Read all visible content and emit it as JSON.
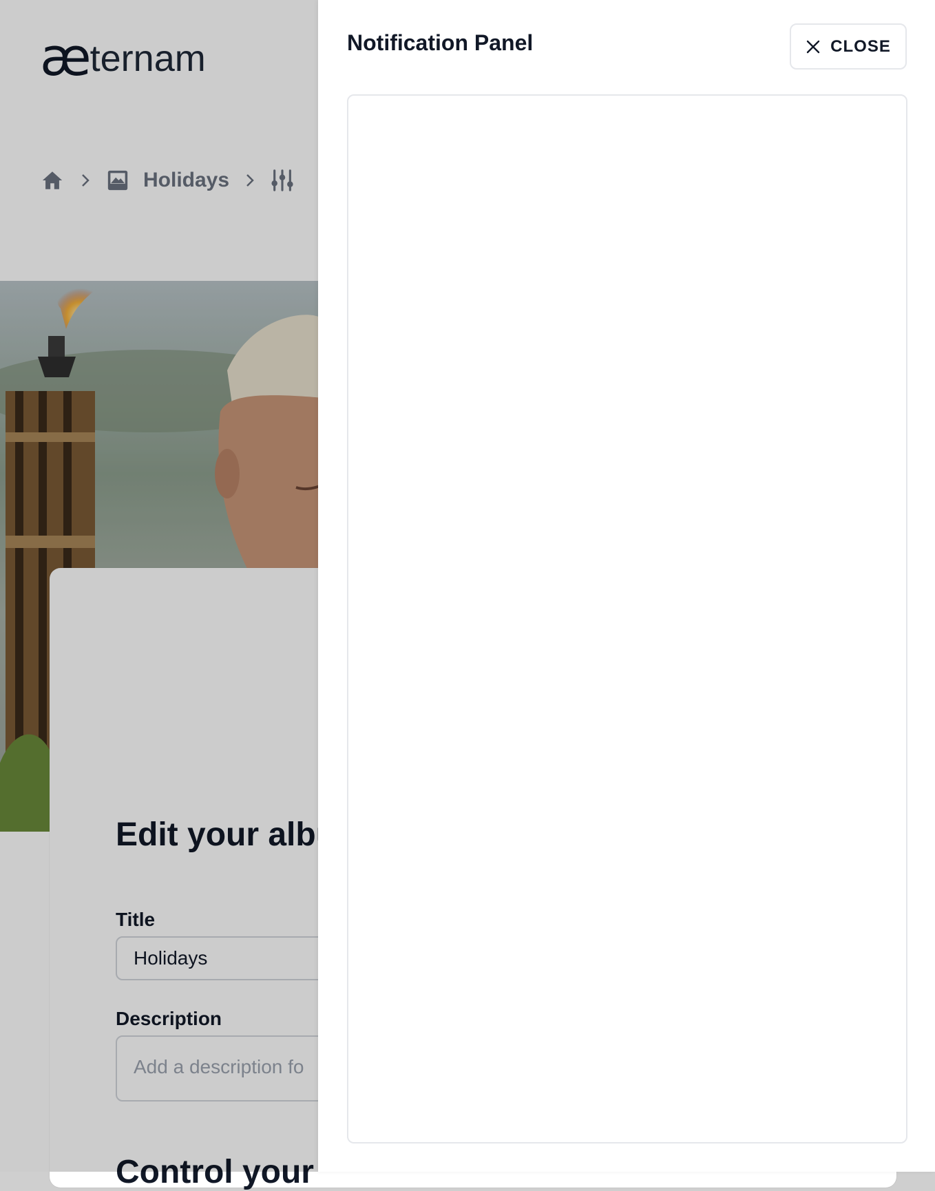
{
  "app": {
    "logo_mark": "æ",
    "logo_text": "ternam"
  },
  "breadcrumb": {
    "items": [
      {
        "icon": "home-icon"
      },
      {
        "icon": "image-icon",
        "label": "Holidays"
      },
      {
        "icon": "sliders-icon"
      }
    ]
  },
  "album_form": {
    "heading": "Edit your albu",
    "title_label": "Title",
    "title_value": "Holidays",
    "description_label": "Description",
    "description_placeholder": "Add a description fo",
    "section_heading": "Control your"
  },
  "notification_panel": {
    "title": "Notification Panel",
    "close_label": "CLOSE",
    "close_icon": "close-icon"
  },
  "colors": {
    "overlay": "rgba(0,0,0,0.2)",
    "text_primary": "#111827",
    "text_muted": "#6b7280",
    "border": "#e5e7eb"
  }
}
